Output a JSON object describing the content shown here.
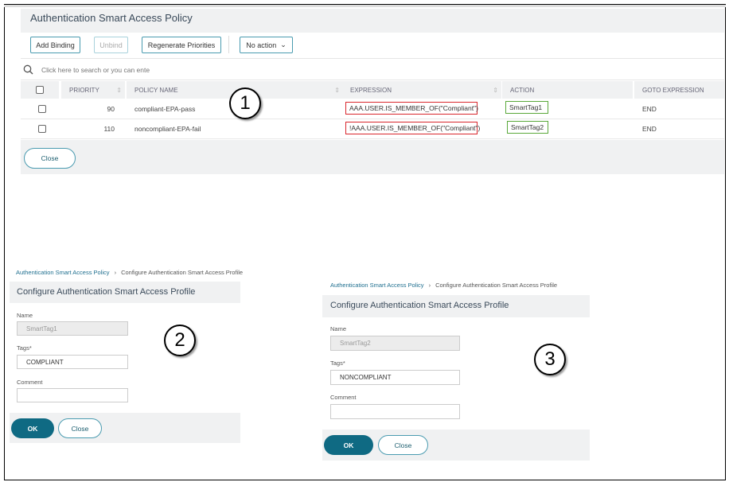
{
  "policy_panel": {
    "title": "Authentication Smart Access Policy",
    "toolbar": {
      "add_binding": "Add Binding",
      "unbind": "Unbind",
      "regenerate": "Regenerate Priorities",
      "action_select": "No action"
    },
    "search_placeholder": "Click here to search or you can ente",
    "columns": [
      "PRIORITY",
      "POLICY NAME",
      "EXPRESSION",
      "ACTION",
      "GOTO EXPRESSION"
    ],
    "rows": [
      {
        "priority": "90",
        "name": "compliant-EPA-pass",
        "expression": "AAA.USER.IS_MEMBER_OF(\"Compliant\")",
        "action": "SmartTag1",
        "goto": "END"
      },
      {
        "priority": "110",
        "name": "noncompliant-EPA-fail",
        "expression": "!AAA.USER.IS_MEMBER_OF(\"Compliant\")",
        "action": "SmartTag2",
        "goto": "END"
      }
    ],
    "close": "Close"
  },
  "callouts": [
    "1",
    "2",
    "3"
  ],
  "profile_left": {
    "breadcrumb": [
      "Authentication Smart Access Policy",
      "Configure Authentication Smart Access Profile"
    ],
    "title": "Configure Authentication Smart Access Profile",
    "name_label": "Name",
    "name_value": "SmartTag1",
    "tags_label": "Tags*",
    "tags_value": "COMPLIANT",
    "comment_label": "Comment",
    "comment_value": "",
    "ok": "OK",
    "close": "Close"
  },
  "profile_right": {
    "breadcrumb": [
      "Authentication Smart Access Policy",
      "Configure Authentication Smart Access Profile"
    ],
    "title": "Configure Authentication Smart Access Profile",
    "name_label": "Name",
    "name_value": "SmartTag2",
    "tags_label": "Tags*",
    "tags_value": "NONCOMPLIANT",
    "comment_label": "Comment",
    "comment_value": "",
    "ok": "OK",
    "close": "Close"
  }
}
